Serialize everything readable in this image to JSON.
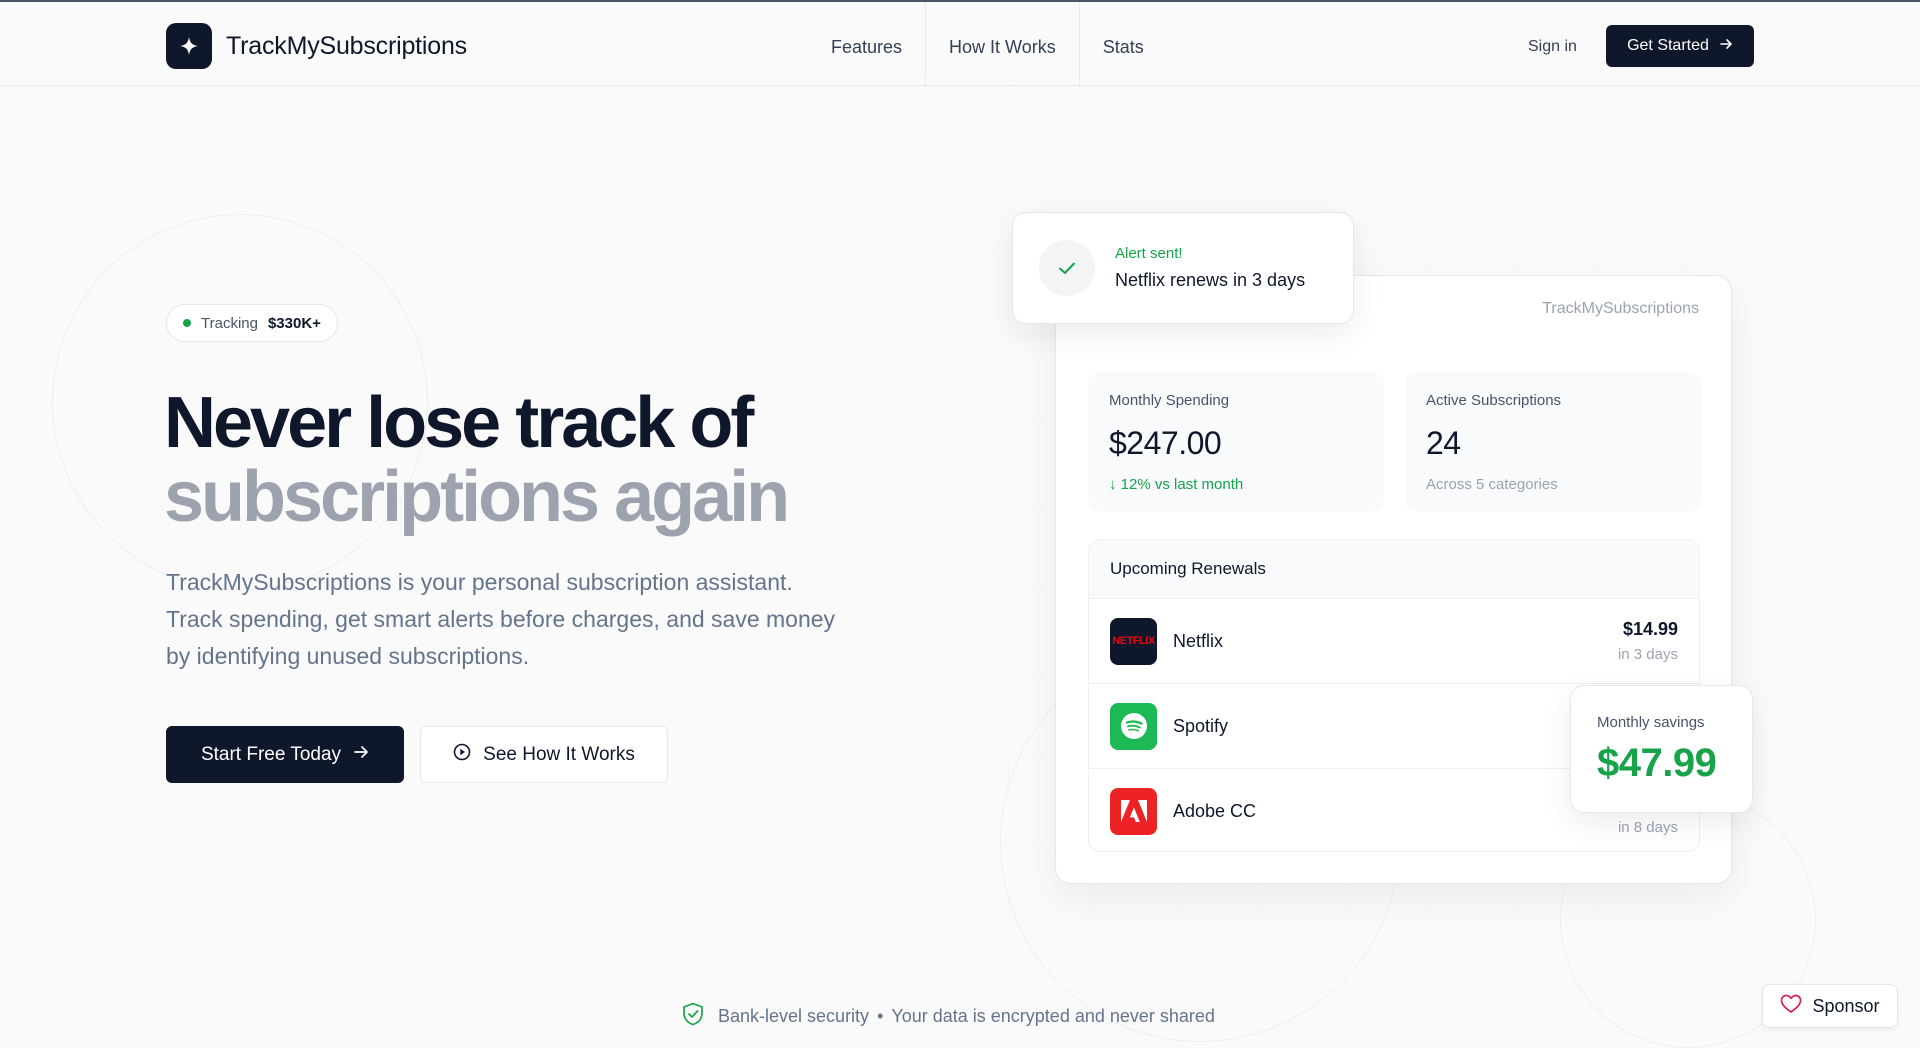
{
  "nav": {
    "brand": "TrackMySubscriptions",
    "links": [
      "Features",
      "How It Works",
      "Stats"
    ],
    "sign_in": "Sign in",
    "get_started": "Get Started"
  },
  "hero": {
    "badge_label": "Tracking",
    "badge_value": "$330K+",
    "headline_line1": "Never lose track of",
    "headline_line2": "subscriptions again",
    "lead": "TrackMySubscriptions is your personal subscription assistant. Track spending, get smart alerts before charges, and save money by identifying unused subscriptions.",
    "primary_cta": "Start Free Today",
    "secondary_cta": "See How It Works"
  },
  "alert": {
    "title": "Alert sent!",
    "text": "Netflix renews in 3 days"
  },
  "dashboard": {
    "brand": "TrackMySubscriptions",
    "monthly_spending": {
      "label": "Monthly Spending",
      "value": "$247.00",
      "sub": "↓ 12% vs last month"
    },
    "active_subscriptions": {
      "label": "Active Subscriptions",
      "value": "24",
      "sub": "Across 5 categories"
    },
    "renewals": {
      "title": "Upcoming Renewals",
      "rows": [
        {
          "name": "Netflix",
          "price": "$14.99",
          "when": "in 3 days",
          "logo_text": "NETFLIX",
          "color": "#0f172a"
        },
        {
          "name": "Spotify",
          "price": "",
          "when": "",
          "color": "#1db954"
        },
        {
          "name": "Adobe CC",
          "price": "",
          "when": "in 8 days",
          "color": "#ed2224"
        }
      ]
    }
  },
  "savings": {
    "label": "Monthly savings",
    "value": "$47.99"
  },
  "footer": {
    "security_a": "Bank-level security",
    "separator": "•",
    "security_b": "Your data is encrypted and never shared",
    "sponsor": "Sponsor"
  },
  "colors": {
    "accent": "#0f172a",
    "success": "#16a34a",
    "muted": "#9ca3af"
  }
}
